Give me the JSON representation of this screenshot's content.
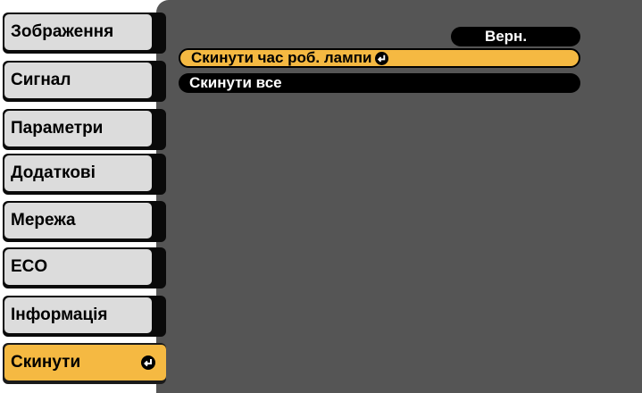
{
  "sidebar": {
    "items": [
      {
        "label": "Зображення"
      },
      {
        "label": "Сигнал"
      },
      {
        "label": "Параметри"
      },
      {
        "label": "Додаткові"
      },
      {
        "label": "Мережа"
      },
      {
        "label": "ECO"
      },
      {
        "label": "Інформація"
      },
      {
        "label": "Скинути",
        "selected": true
      }
    ]
  },
  "content": {
    "back_label": "Верн.",
    "items": [
      {
        "label": "Скинути час роб. лампи",
        "highlighted": true
      },
      {
        "label": "Скинути все"
      }
    ]
  },
  "colors": {
    "highlight": "#f5b942",
    "panel": "#555555",
    "tab_face": "#dcdcdc"
  },
  "icons": {
    "enter": "enter-return-icon"
  }
}
